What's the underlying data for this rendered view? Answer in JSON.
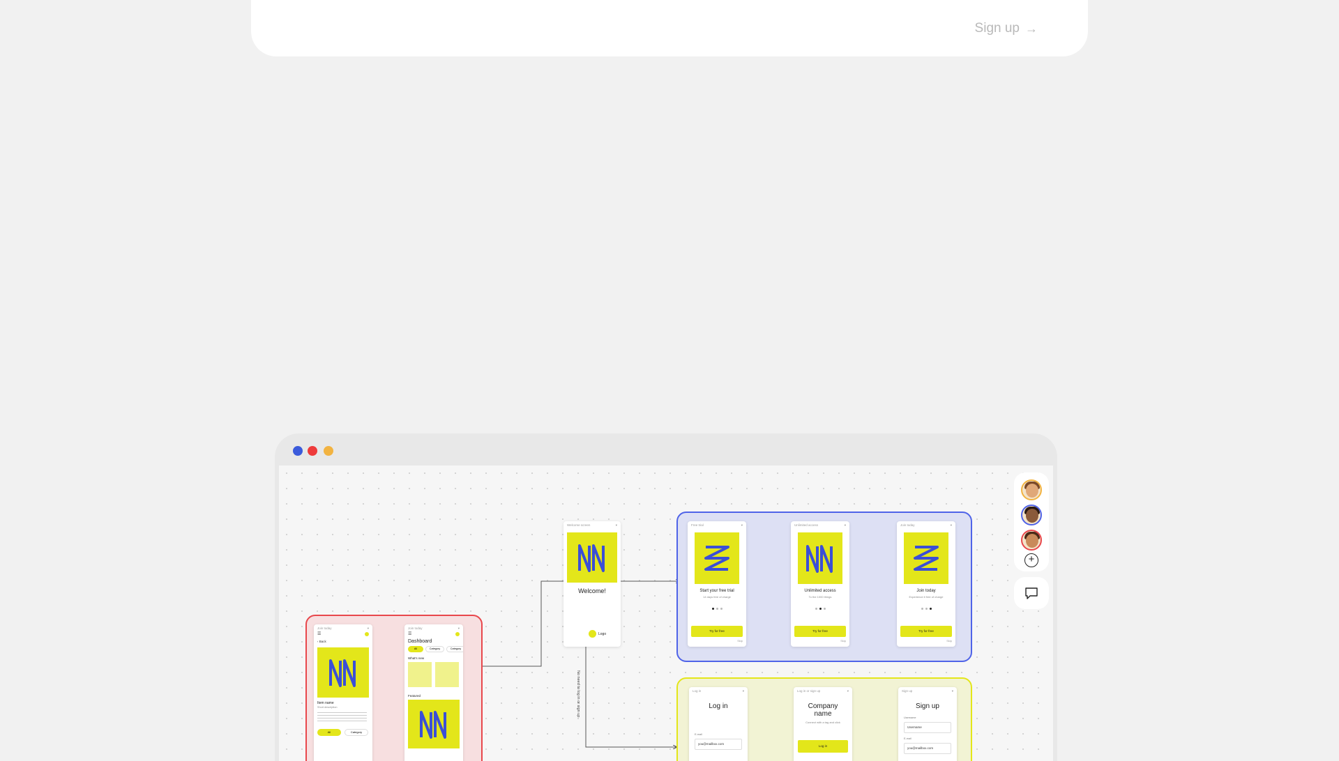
{
  "header": {
    "signup_label": "Sign up",
    "signup_arrow": "→"
  },
  "window": {
    "traffic_lights": [
      "#3b5bdb",
      "#ee3b3b",
      "#f2b341"
    ],
    "canvas": {
      "welcome_screen": {
        "bar_title": "Welcome screen",
        "title": "Welcome!",
        "logo_label": "Logo"
      },
      "onboarding_group": {
        "color": "#4f63e8",
        "screens": [
          {
            "bar_title": "Free trial",
            "title": "Start your free trial",
            "subtitle": "14 days free of charge",
            "button": "Try for free",
            "skip": "Skip"
          },
          {
            "bar_title": "Unlimited access",
            "title": "Unlimited access",
            "subtitle": "To the 1000 things",
            "button": "Try for free",
            "skip": "Skip"
          },
          {
            "bar_title": "Join today",
            "title": "Join today",
            "subtitle": "Experience it free of charge",
            "button": "Try for free",
            "skip": "Skip"
          }
        ]
      },
      "auth_group": {
        "color": "#e3e61a",
        "screens": [
          {
            "bar_title": "Log in",
            "title": "Log in",
            "field_label": "E-mail",
            "field_value": "you@mailbox.com"
          },
          {
            "bar_title": "Log in or sign up",
            "title": "Company name",
            "subtitle": "Connect with a tag and click",
            "button": "Log in"
          },
          {
            "bar_title": "Sign up",
            "title": "Sign up",
            "field1_label": "Username",
            "field1_value": "Username",
            "field2_label": "E-mail",
            "field2_value": "you@mailbox.com"
          }
        ]
      },
      "app_group": {
        "color": "#e8474c",
        "item_screen": {
          "bar_title": "Join today",
          "back": "Back",
          "item_name": "Item name",
          "item_desc": "Short description",
          "chip_all": "All",
          "chip_category": "Category"
        },
        "dashboard_screen": {
          "bar_title": "Join today",
          "title": "Dashboard",
          "chips": [
            "All",
            "Category",
            "Category"
          ],
          "whats_new": "What's new",
          "featured": "Featured"
        }
      },
      "connector_label": "No need to log in or sign up"
    },
    "toolbar": {
      "avatars": [
        {
          "ring": "#f2b341",
          "skin": "#e0a878",
          "hair": "#7a4a2a"
        },
        {
          "ring": "#4f63e8",
          "skin": "#8a5a3a",
          "hair": "#2a1a12"
        },
        {
          "ring": "#e8474c",
          "skin": "#c98a5a",
          "hair": "#4a2a18"
        }
      ],
      "add_symbol": "+"
    }
  }
}
